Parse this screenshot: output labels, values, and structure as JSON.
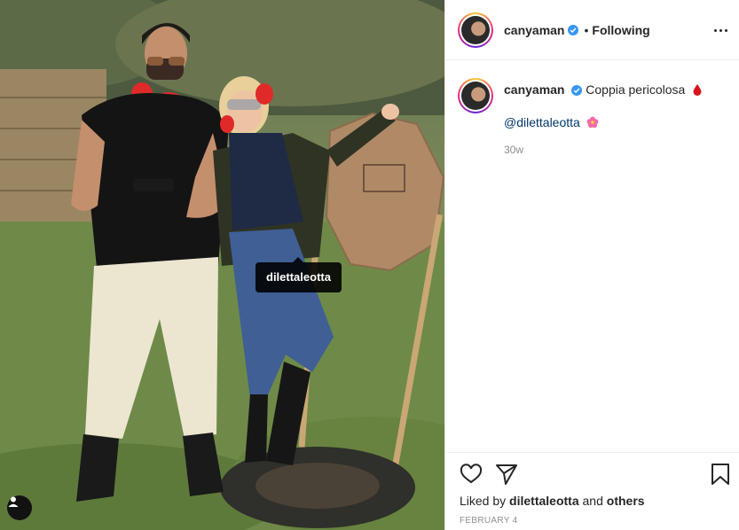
{
  "photo": {
    "tag_label": "dilettaleotta",
    "tag_user_icon": "user-tag-icon"
  },
  "header": {
    "username": "canyaman",
    "verified_icon": "verified-badge-icon",
    "separator": "•",
    "follow_label": "Following",
    "more_icon": "more-options-icon"
  },
  "caption": {
    "username": "canyaman",
    "text": "Coppia pericolosa",
    "emoji_icon": "blood-drop-icon",
    "mention": "@dilettaleotta",
    "mention_emoji_icon": "hibiscus-icon",
    "time_ago": "30w"
  },
  "actions": {
    "like_icon": "heart-icon",
    "share_icon": "paper-plane-icon",
    "save_icon": "bookmark-icon",
    "liked_prefix": "Liked by",
    "liked_user": "dilettaleotta",
    "liked_and": "and",
    "liked_others": "others",
    "date": "FEBRUARY 4"
  },
  "colors": {
    "link": "#00376b",
    "verified": "#3897f0",
    "muted": "#8e8e8e",
    "border": "#efefef"
  }
}
